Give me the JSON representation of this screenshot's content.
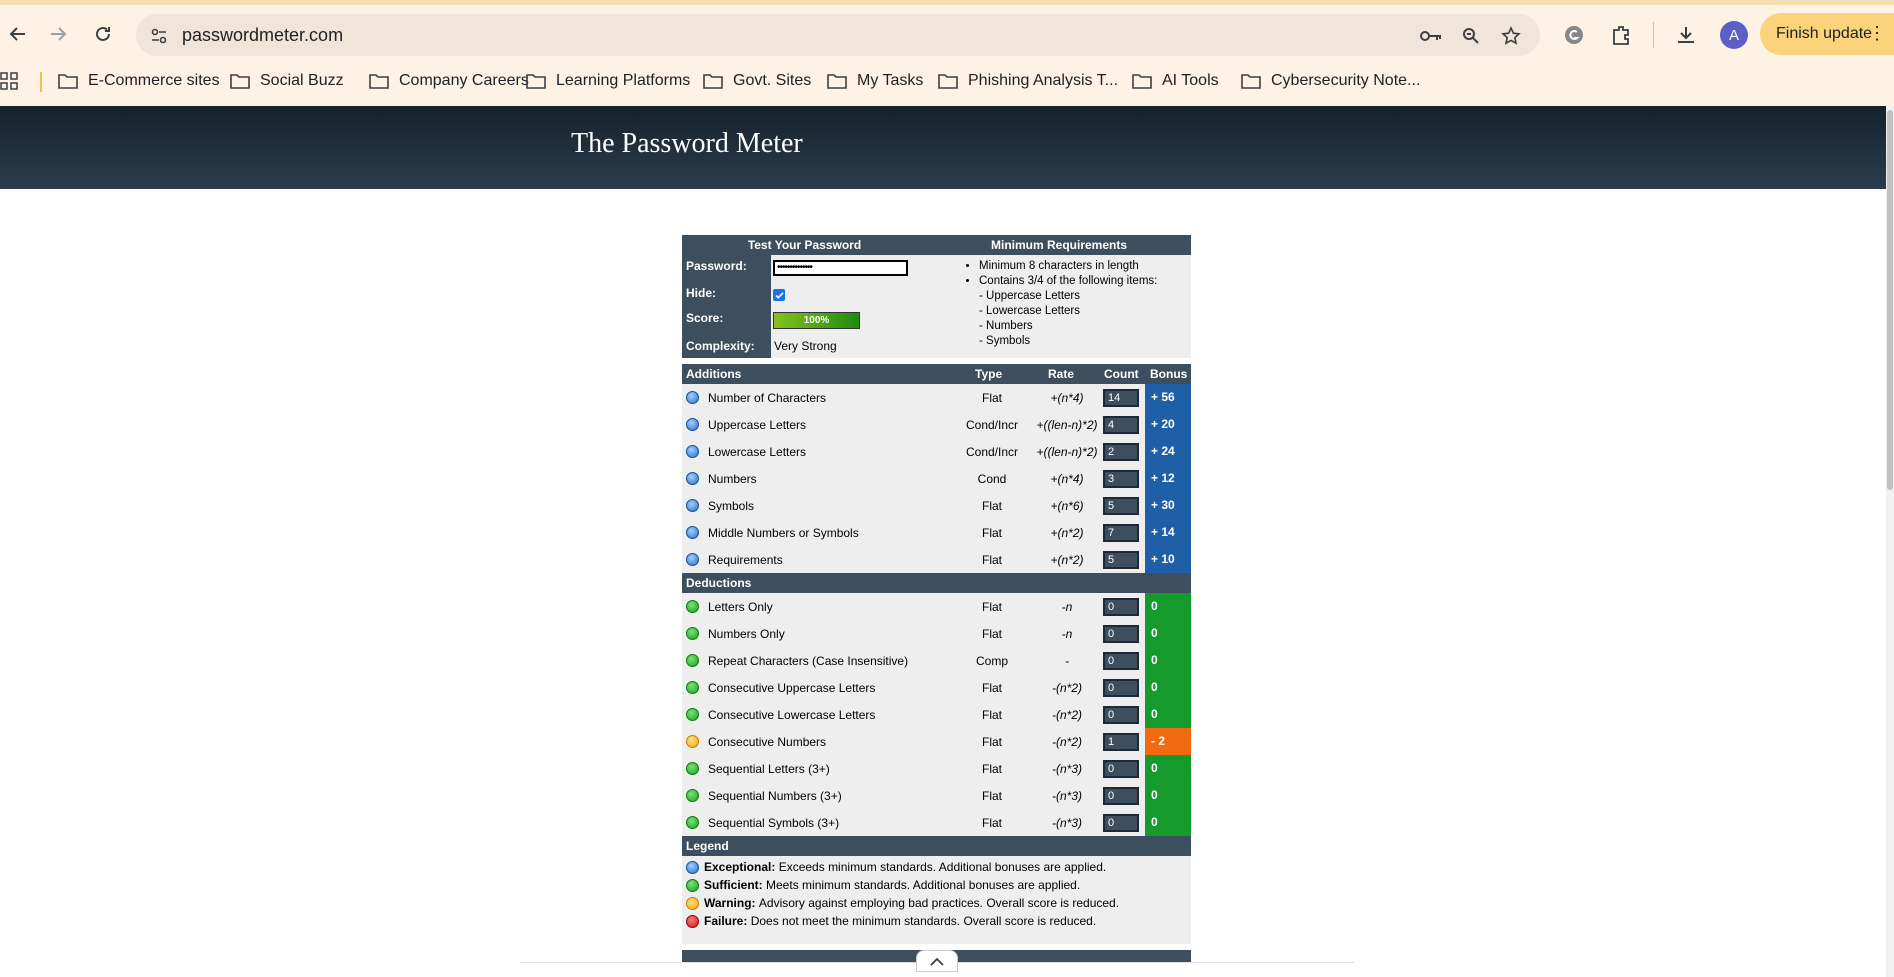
{
  "browser": {
    "url": "passwordmeter.com",
    "avatar_letter": "A",
    "update_label": "Finish update",
    "bookmarks": [
      "E-Commerce sites",
      "Social Buzz",
      "Company Careers",
      "Learning Platforms",
      "Govt. Sites",
      "My Tasks",
      "Phishing Analysis T...",
      "AI Tools",
      "Cybersecurity Note..."
    ]
  },
  "site": {
    "title": "The Password Meter"
  },
  "test": {
    "header_left": "Test Your Password",
    "header_right": "Minimum Requirements",
    "password_label": "Password:",
    "password_value": "••••••••••••••",
    "hide_label": "Hide:",
    "hide_checked": true,
    "score_label": "Score:",
    "score_value": "100%",
    "score_fraction": 1.0,
    "complexity_label": "Complexity:",
    "complexity_value": "Very Strong",
    "requirements": {
      "min_length": "Minimum 8 characters in length",
      "contains": "Contains 3/4 of the following items:",
      "items": [
        "- Uppercase Letters",
        "- Lowercase Letters",
        "- Numbers",
        "- Symbols"
      ]
    }
  },
  "additions": {
    "title": "Additions",
    "col_type": "Type",
    "col_rate": "Rate",
    "col_count": "Count",
    "col_bonus": "Bonus",
    "rows": [
      {
        "name": "Number of Characters",
        "type": "Flat",
        "rate": "+(n*4)",
        "count": "14",
        "bonus": "+ 56",
        "status": "exceptional"
      },
      {
        "name": "Uppercase Letters",
        "type": "Cond/Incr",
        "rate": "+((len-n)*2)",
        "count": "4",
        "bonus": "+ 20",
        "status": "exceptional"
      },
      {
        "name": "Lowercase Letters",
        "type": "Cond/Incr",
        "rate": "+((len-n)*2)",
        "count": "2",
        "bonus": "+ 24",
        "status": "exceptional"
      },
      {
        "name": "Numbers",
        "type": "Cond",
        "rate": "+(n*4)",
        "count": "3",
        "bonus": "+ 12",
        "status": "exceptional"
      },
      {
        "name": "Symbols",
        "type": "Flat",
        "rate": "+(n*6)",
        "count": "5",
        "bonus": "+ 30",
        "status": "exceptional"
      },
      {
        "name": "Middle Numbers or Symbols",
        "type": "Flat",
        "rate": "+(n*2)",
        "count": "7",
        "bonus": "+ 14",
        "status": "exceptional"
      },
      {
        "name": "Requirements",
        "type": "Flat",
        "rate": "+(n*2)",
        "count": "5",
        "bonus": "+ 10",
        "status": "exceptional"
      }
    ]
  },
  "deductions": {
    "title": "Deductions",
    "rows": [
      {
        "name": "Letters Only",
        "type": "Flat",
        "rate": "-n",
        "count": "0",
        "bonus": "0",
        "status": "sufficient"
      },
      {
        "name": "Numbers Only",
        "type": "Flat",
        "rate": "-n",
        "count": "0",
        "bonus": "0",
        "status": "sufficient"
      },
      {
        "name": "Repeat Characters (Case Insensitive)",
        "type": "Comp",
        "rate": "-",
        "count": "0",
        "bonus": "0",
        "status": "sufficient"
      },
      {
        "name": "Consecutive Uppercase Letters",
        "type": "Flat",
        "rate": "-(n*2)",
        "count": "0",
        "bonus": "0",
        "status": "sufficient"
      },
      {
        "name": "Consecutive Lowercase Letters",
        "type": "Flat",
        "rate": "-(n*2)",
        "count": "0",
        "bonus": "0",
        "status": "sufficient"
      },
      {
        "name": "Consecutive Numbers",
        "type": "Flat",
        "rate": "-(n*2)",
        "count": "1",
        "bonus": "- 2",
        "status": "warning"
      },
      {
        "name": "Sequential Letters (3+)",
        "type": "Flat",
        "rate": "-(n*3)",
        "count": "0",
        "bonus": "0",
        "status": "sufficient"
      },
      {
        "name": "Sequential Numbers (3+)",
        "type": "Flat",
        "rate": "-(n*3)",
        "count": "0",
        "bonus": "0",
        "status": "sufficient"
      },
      {
        "name": "Sequential Symbols (3+)",
        "type": "Flat",
        "rate": "-(n*3)",
        "count": "0",
        "bonus": "0",
        "status": "sufficient"
      }
    ]
  },
  "legend": {
    "title": "Legend",
    "items": [
      {
        "term": "Exceptional:",
        "desc": "Exceeds minimum standards. Additional bonuses are applied.",
        "status": "exceptional"
      },
      {
        "term": "Sufficient:",
        "desc": "Meets minimum standards. Additional bonuses are applied.",
        "status": "sufficient"
      },
      {
        "term": "Warning:",
        "desc": "Advisory against employing bad practices. Overall score is reduced.",
        "status": "warning"
      },
      {
        "term": "Failure:",
        "desc": "Does not meet the minimum standards. Overall score is reduced.",
        "status": "failure"
      }
    ]
  },
  "colors": {
    "blue_bonus": "#1f5fa8",
    "green_bonus": "#149b2c",
    "orange_bonus": "#f26a0f",
    "header": "#3d4f5f"
  }
}
